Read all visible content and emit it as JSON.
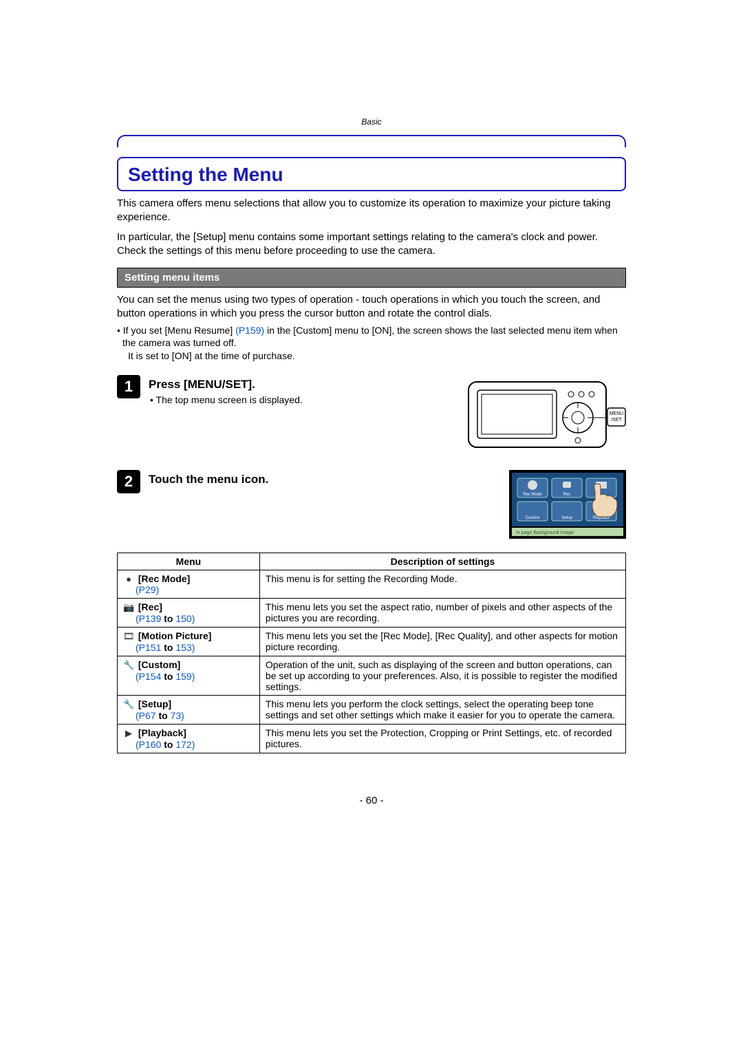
{
  "section_label": "Basic",
  "title": "Setting the Menu",
  "intro_p1": "This camera offers menu selections that allow you to customize its operation to maximize your picture taking experience.",
  "intro_p2": "In particular, the [Setup] menu contains some important settings relating to the camera's clock and power. Check the settings of this menu before proceeding to use the camera.",
  "subheading": "Setting menu items",
  "sub_intro": "You can set the menus using two types of operation - touch operations in which you touch the screen, and button operations in which you press the cursor button and rotate the control dials.",
  "note_prefix": "• If you set [Menu Resume] ",
  "note_link": "(P159)",
  "note_rest": " in the [Custom] menu to [ON], the screen shows the last selected menu item when the camera was turned off.",
  "note_line2": "It is set to [ON] at the time of purchase.",
  "step1_num": "1",
  "step1_title": "Press [MENU/SET].",
  "step1_sub": "• The top menu screen is displayed.",
  "menu_set_label": "MENU\n/SET",
  "step2_num": "2",
  "step2_title": "Touch the menu icon.",
  "screen_labels": {
    "rec_mode": "Rec Mode",
    "rec": "Rec",
    "custom": "Custom",
    "setup": "Setup",
    "playback": "Playback",
    "bg": "⇆ page Background Image"
  },
  "table": {
    "header_menu": "Menu",
    "header_desc": "Description of settings",
    "rows": [
      {
        "icon": "●",
        "label": "[Rec Mode]",
        "pages_pre": "(P29)",
        "pages_mid": "",
        "pages_post": "",
        "desc": "This menu is for setting the Recording Mode."
      },
      {
        "icon": "📷",
        "label": "[Rec]",
        "pages_pre": "(P139",
        "pages_mid": " to ",
        "pages_post": "150)",
        "desc": "This menu lets you set the aspect ratio, number of pixels and other aspects of the pictures you are recording."
      },
      {
        "icon": "🎞",
        "label": "[Motion Picture]",
        "pages_pre": "(P151",
        "pages_mid": " to ",
        "pages_post": "153)",
        "desc": "This menu lets you set the [Rec Mode], [Rec Quality], and other aspects for motion picture recording."
      },
      {
        "icon": "🔧",
        "label": "[Custom]",
        "pages_pre": "(P154",
        "pages_mid": " to ",
        "pages_post": "159)",
        "desc": "Operation of the unit, such as displaying of the screen and button operations, can be set up according to your preferences. Also, it is possible to register the modified settings."
      },
      {
        "icon": "🔧",
        "label": "[Setup]",
        "pages_pre": "(P67",
        "pages_mid": " to ",
        "pages_post": "73)",
        "desc": "This menu lets you perform the clock settings, select the operating beep tone settings and set other settings which make it easier for you to operate the camera."
      },
      {
        "icon": "▶",
        "label": "[Playback]",
        "pages_pre": "(P160",
        "pages_mid": " to ",
        "pages_post": "172)",
        "desc": "This menu lets you set the Protection, Cropping or Print Settings, etc. of recorded pictures."
      }
    ]
  },
  "page_number": "- 60 -"
}
